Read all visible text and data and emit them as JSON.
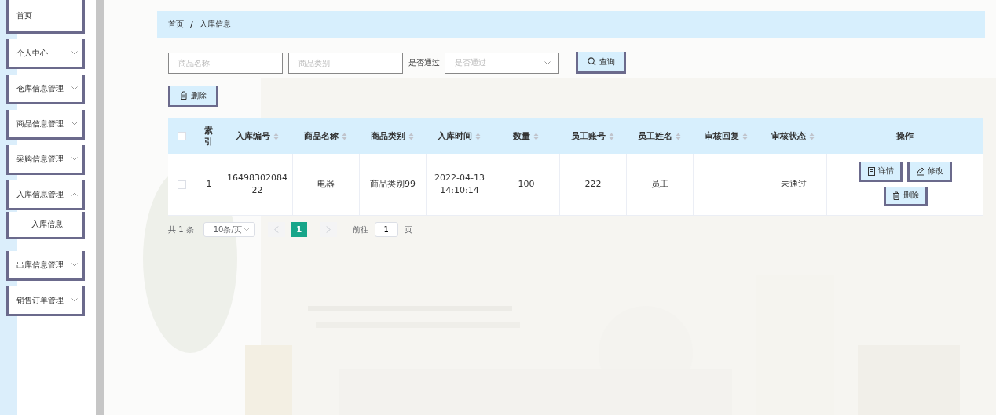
{
  "sidebar": {
    "items": [
      {
        "label": "首页",
        "kind": "link"
      },
      {
        "label": "个人中心",
        "kind": "group",
        "expanded": false
      },
      {
        "label": "仓库信息管理",
        "kind": "group",
        "expanded": false
      },
      {
        "label": "商品信息管理",
        "kind": "group",
        "expanded": false
      },
      {
        "label": "采购信息管理",
        "kind": "group",
        "expanded": false
      },
      {
        "label": "入库信息管理",
        "kind": "group",
        "expanded": true,
        "children": [
          {
            "label": "入库信息",
            "kind": "link"
          }
        ]
      },
      {
        "label": "出库信息管理",
        "kind": "group",
        "expanded": false
      },
      {
        "label": "销售订单管理",
        "kind": "group",
        "expanded": false
      }
    ]
  },
  "breadcrumb": {
    "separator": "/",
    "items": [
      "首页",
      "入库信息"
    ]
  },
  "search": {
    "fields": [
      {
        "kind": "input",
        "placeholder": "商品名称"
      },
      {
        "kind": "input",
        "placeholder": "商品类别"
      },
      {
        "kind": "select",
        "label": "是否通过",
        "placeholder": "是否通过"
      }
    ],
    "button": "查询"
  },
  "toolbar": {
    "delete_button": "删除"
  },
  "table": {
    "select_all": {
      "checked": false
    },
    "columns": [
      {
        "label": "索引",
        "sortable": false
      },
      {
        "label": "入库编号",
        "sortable": true
      },
      {
        "label": "商品名称",
        "sortable": true
      },
      {
        "label": "商品类别",
        "sortable": true
      },
      {
        "label": "入库时间",
        "sortable": true
      },
      {
        "label": "数量",
        "sortable": true
      },
      {
        "label": "员工账号",
        "sortable": true
      },
      {
        "label": "员工姓名",
        "sortable": true
      },
      {
        "label": "审核回复",
        "sortable": true
      },
      {
        "label": "审核状态",
        "sortable": true
      },
      {
        "label": "操作",
        "sortable": false
      }
    ],
    "rows": [
      {
        "checked": false,
        "cells": [
          "1",
          "1649830208422",
          "电器",
          "商品类别99",
          "2022-04-13 14:10:14",
          "100",
          "222",
          "员工",
          "",
          "未通过"
        ],
        "actions": [
          {
            "kind": "detail",
            "label": "详情"
          },
          {
            "kind": "edit",
            "label": "修改"
          },
          {
            "kind": "delete",
            "label": "删除"
          }
        ]
      }
    ]
  },
  "pagination": {
    "total": "共 1 条",
    "page_size": "10条/页",
    "prev_disabled": true,
    "next_disabled": true,
    "pages": [
      {
        "label": "1",
        "selected": true
      }
    ],
    "goto_label": "前往",
    "goto_value": "1",
    "goto_suffix": "页"
  }
}
